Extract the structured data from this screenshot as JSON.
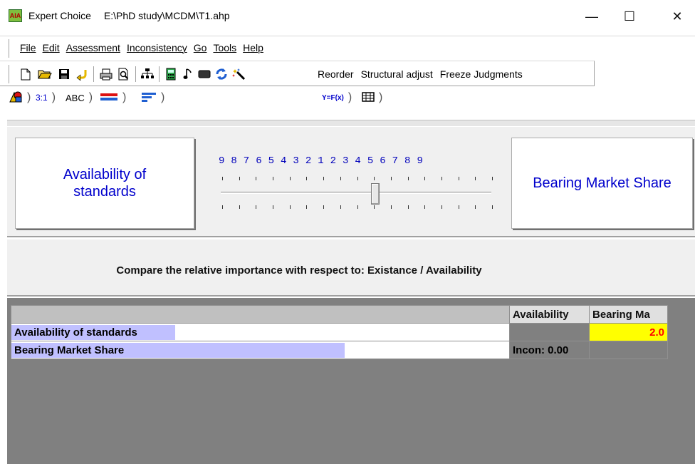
{
  "window": {
    "app_name": "Expert Choice",
    "file_path": "E:\\PhD study\\MCDM\\T1.ahp",
    "icon_text": "AIA",
    "controls": {
      "minimize": "—",
      "maximize": "☐",
      "close": "✕"
    }
  },
  "menu": {
    "items": [
      "File",
      "Edit",
      "Assessment",
      "Inconsistency",
      "Go",
      "Tools",
      "Help"
    ]
  },
  "toolbar": {
    "icons": [
      "new-file-icon",
      "open-folder-icon",
      "save-icon",
      "undo-icon",
      "print-icon",
      "print-preview-icon",
      "hierarchy-icon",
      "calculator-icon",
      "music-note-icon",
      "rectangle-icon",
      "refresh-icon",
      "magic-wand-icon"
    ],
    "reorder": "Reorder",
    "structural_adjust": "Structural adjust",
    "freeze_judgments": "Freeze Judgments"
  },
  "tabs": {
    "numerical": "3:1",
    "verbal": "ABC",
    "graphical": "",
    "questionnaire": "",
    "formula": "Y=F(x)",
    "matrix": ""
  },
  "comparison": {
    "left_element": "Availability of standards",
    "right_element": "Bearing Market Share",
    "scale_labels": "9 8 7 6 5 4 3 2 1 2 3 4 5 6 7 8 9",
    "slider_value": 2.0,
    "slider_side": "right",
    "prompt": "Compare the relative importance  with respect to: Existance / Availability"
  },
  "matrix": {
    "columns": [
      "Availability",
      "Bearing Ma"
    ],
    "rows": [
      {
        "label": "Availability of standards",
        "cells": [
          "",
          "2.0"
        ]
      },
      {
        "label": "Bearing Market Share",
        "cells": [
          "Incon: 0.00",
          ""
        ]
      }
    ]
  },
  "colors": {
    "highlight_row": "#c0c0ff",
    "judgment_bg": "#ffff00",
    "judgment_text": "#ff0000",
    "element_text": "#0000cc",
    "grid_bg": "#808080"
  }
}
